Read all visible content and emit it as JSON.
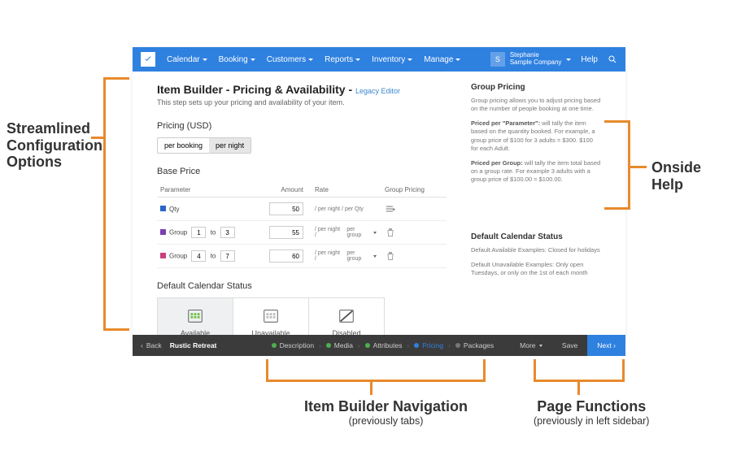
{
  "nav": {
    "items": [
      "Calendar",
      "Booking",
      "Customers",
      "Reports",
      "Inventory",
      "Manage"
    ],
    "user_initial": "S",
    "user_name": "Stephanie",
    "company": "Sample Company",
    "help": "Help"
  },
  "page": {
    "title_prefix": "Item Builder - Pricing & Availability - ",
    "legacy": "Legacy Editor",
    "subtitle": "This step sets up your pricing and availability of your item."
  },
  "pricing": {
    "heading": "Pricing (USD)",
    "seg_booking": "per booking",
    "seg_night": "per night"
  },
  "baseprice": {
    "heading": "Base Price",
    "cols": {
      "param": "Parameter",
      "amount": "Amount",
      "rate": "Rate",
      "gp": "Group Pricing"
    },
    "rows": [
      {
        "label": "Qty",
        "amount": "50",
        "rate": "/ per night / per Qty",
        "group_sel": ""
      },
      {
        "label": "Group",
        "from": "1",
        "to": "3",
        "amount": "55",
        "rate": "/ per night /",
        "group_sel": "per group"
      },
      {
        "label": "Group",
        "from": "4",
        "to": "7",
        "amount": "60",
        "rate": "/ per night /",
        "group_sel": "per group"
      }
    ]
  },
  "calendar": {
    "heading": "Default Calendar Status",
    "options": [
      "Available",
      "Unavailable",
      "Disabled"
    ]
  },
  "help": {
    "gp_head": "Group Pricing",
    "gp_intro": "Group pricing allows you to adjust pricing based on the number of people booking at one time.",
    "gp_param_b": "Priced per \"Parameter\":",
    "gp_param": " will tally the item based on the quantity booked. For example, a group price of $100 for 3 adults = $300. $100 for each Adult.",
    "gp_group_b": "Priced per Group:",
    "gp_group": " will tally the item total based on a group rate. For example 3 adults with a group price of $100.00 = $100.00.",
    "cal_head": "Default Calendar Status",
    "cal_avail": "Default Available Examples: Closed for holidays",
    "cal_unavail": "Default Unavailable Examples: Only open Tuesdays, or only on the 1st of each month"
  },
  "bottom": {
    "back": "Back",
    "item_name": "Rustic Retreat",
    "steps": [
      "Description",
      "Media",
      "Attributes",
      "Pricing",
      "Packages"
    ],
    "more": "More",
    "save": "Save",
    "next": "Next"
  },
  "callouts": {
    "config": "Streamlined\nConfiguration\nOptions",
    "help": "Onside Help",
    "nav": "Item Builder Navigation",
    "nav_sub": "(previously tabs)",
    "func": "Page Functions",
    "func_sub": "(previously in left sidebar)"
  }
}
